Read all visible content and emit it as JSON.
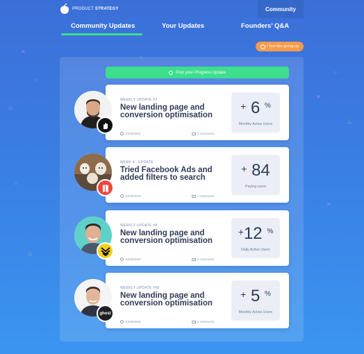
{
  "header": {
    "logo_text_light": "PRODUCT",
    "logo_text_bold": "STRATEGY",
    "active_nav": "Community"
  },
  "tabs": [
    {
      "label": "Community Updates",
      "active": true
    },
    {
      "label": "Your Updates",
      "active": false
    },
    {
      "label": "Founders’ Q&A",
      "active": false
    }
  ],
  "give_up_button": "I feel like giving up",
  "post_button": "Post your Progress Update",
  "updates": [
    {
      "label": "WEEKLY UPDATE #2",
      "title": "New landing page and conversion optimisation",
      "date": "24/08/2018",
      "comments": "3 comments",
      "stat_sign": "+",
      "stat_value": "6",
      "stat_suffix": "%",
      "stat_metric": "Monthly Active Users",
      "badge_icon": "hand-logo-icon",
      "badge_color": "#111111"
    },
    {
      "label": "WEEK 4 - UPDATE",
      "title": "Tried Facebook Ads and added filters to search",
      "date": "24/08/2018",
      "comments": "2 comments",
      "stat_sign": "+",
      "stat_value": "84",
      "stat_suffix": "",
      "stat_metric": "Paying users",
      "badge_icon": "map-logo-icon",
      "badge_color": "#f0473d"
    },
    {
      "label": "WEEKLY UPDATE #8",
      "title": "New landing page and conversion optimisation",
      "date": "24/08/2018",
      "comments": "2 comments",
      "stat_sign": "+",
      "stat_value": "12",
      "stat_suffix": "%",
      "stat_metric": "Daily Active Users",
      "badge_icon": "chevron-logo-icon",
      "badge_color": "#f7d21a"
    },
    {
      "label": "WEEKLY UPDATE #58",
      "title": "New landing page and conversion optimisation",
      "date": "24/08/2018",
      "comments": "2 comments",
      "stat_sign": "+",
      "stat_value": "5",
      "stat_suffix": "%",
      "stat_metric": "Monthly Active Users",
      "badge_icon": "ghost-logo-icon",
      "badge_color": "#1d1f22",
      "badge_text": "ghost"
    }
  ],
  "colors": {
    "accent_green": "#3dde8c",
    "accent_orange": "#f79b4a",
    "background_top": "#3b6fd8",
    "background_bottom": "#3b95f0"
  }
}
